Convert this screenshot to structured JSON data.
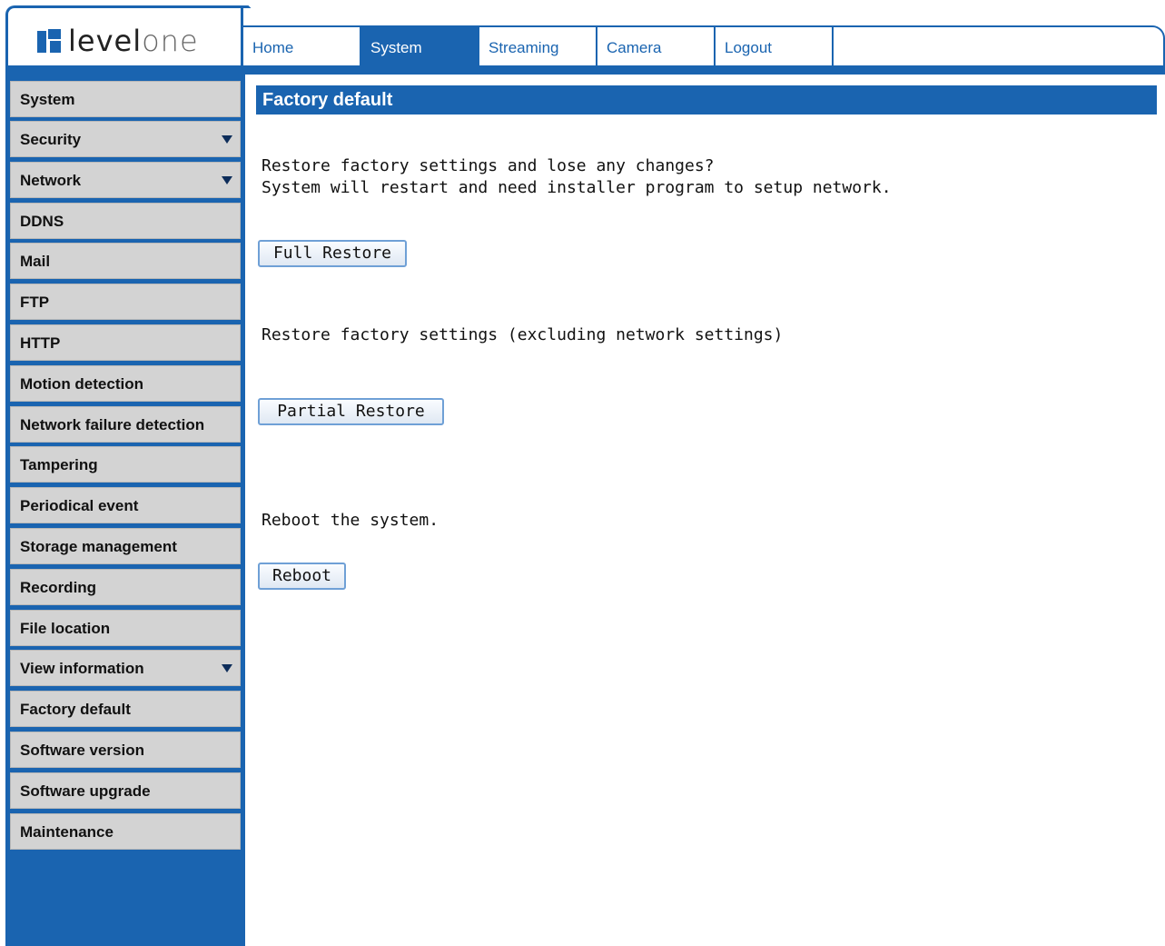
{
  "brand": {
    "logo_part1": "level",
    "logo_part2": "one"
  },
  "nav": {
    "tabs": [
      "Home",
      "System",
      "Streaming",
      "Camera",
      "Logout"
    ],
    "active": "System"
  },
  "sidebar": {
    "items": [
      {
        "label": "System",
        "has_submenu": false
      },
      {
        "label": "Security",
        "has_submenu": true
      },
      {
        "label": "Network",
        "has_submenu": true
      },
      {
        "label": "DDNS",
        "has_submenu": false
      },
      {
        "label": "Mail",
        "has_submenu": false
      },
      {
        "label": "FTP",
        "has_submenu": false
      },
      {
        "label": "HTTP",
        "has_submenu": false
      },
      {
        "label": "Motion detection",
        "has_submenu": false
      },
      {
        "label": "Network failure detection",
        "has_submenu": false
      },
      {
        "label": "Tampering",
        "has_submenu": false
      },
      {
        "label": "Periodical event",
        "has_submenu": false
      },
      {
        "label": "Storage management",
        "has_submenu": false
      },
      {
        "label": "Recording",
        "has_submenu": false
      },
      {
        "label": "File location",
        "has_submenu": false
      },
      {
        "label": "View information",
        "has_submenu": true
      },
      {
        "label": "Factory default",
        "has_submenu": false
      },
      {
        "label": "Software version",
        "has_submenu": false
      },
      {
        "label": "Software upgrade",
        "has_submenu": false
      },
      {
        "label": "Maintenance",
        "has_submenu": false
      }
    ]
  },
  "main": {
    "title": "Factory default",
    "full_restore_text_1": "Restore factory settings and lose any changes?",
    "full_restore_text_2": "System will restart and need installer program to setup network.",
    "full_restore_button": "Full Restore",
    "partial_restore_text": "Restore factory settings (excluding network settings)",
    "partial_restore_button": "Partial Restore",
    "reboot_text": "Reboot the system.",
    "reboot_button": "Reboot"
  },
  "colors": {
    "accent": "#1a64b0",
    "menu_bg": "#d3d3d3"
  }
}
